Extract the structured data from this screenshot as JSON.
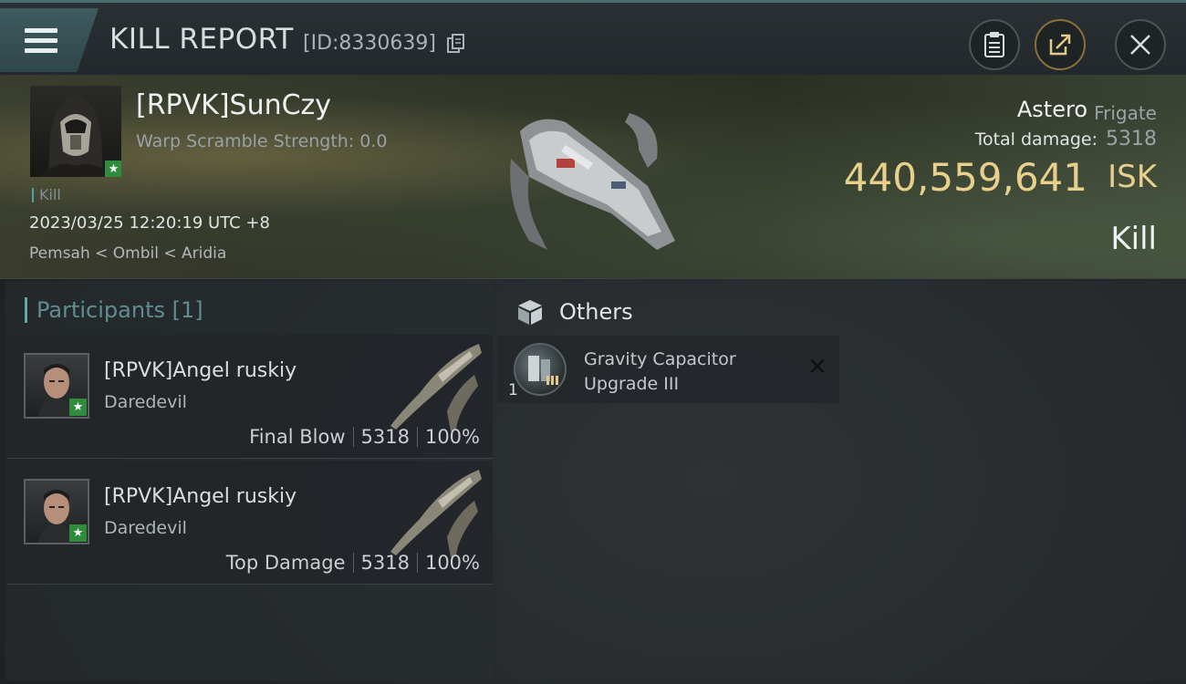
{
  "header": {
    "title": "KILL REPORT",
    "report_id": "[ID:8330639]",
    "icons": [
      "menu-icon",
      "copy-icon",
      "clipboard-icon",
      "share-icon",
      "close-icon"
    ]
  },
  "victim": {
    "name": "[RPVK]SunCzy",
    "warp_scramble": "Warp Scramble Strength: 0.0",
    "tag": "Kill",
    "datetime": "2023/03/25 12:20:19 UTC +8",
    "location": "Pemsah < Ombil < Aridia",
    "ship_name": "Astero",
    "ship_class": "Frigate",
    "total_damage_label": "Total damage:",
    "total_damage": "5318",
    "isk_value": "440,559,641",
    "isk_unit": "ISK",
    "result": "Kill"
  },
  "participants": {
    "heading": "Participants [1]",
    "items": [
      {
        "name": "[RPVK]Angel ruskiy",
        "ship": "Daredevil",
        "role": "Final Blow",
        "damage": "5318",
        "percent": "100%"
      },
      {
        "name": "[RPVK]Angel ruskiy",
        "ship": "Daredevil",
        "role": "Top Damage",
        "damage": "5318",
        "percent": "100%"
      }
    ]
  },
  "others": {
    "heading": "Others",
    "items": [
      {
        "qty": "1",
        "name": "Gravity Capacitor Upgrade III",
        "status": "destroyed"
      }
    ]
  },
  "colors": {
    "accent": "#5fa9ae",
    "isk": "#e8cf8c",
    "badge": "#2e8c3c"
  }
}
